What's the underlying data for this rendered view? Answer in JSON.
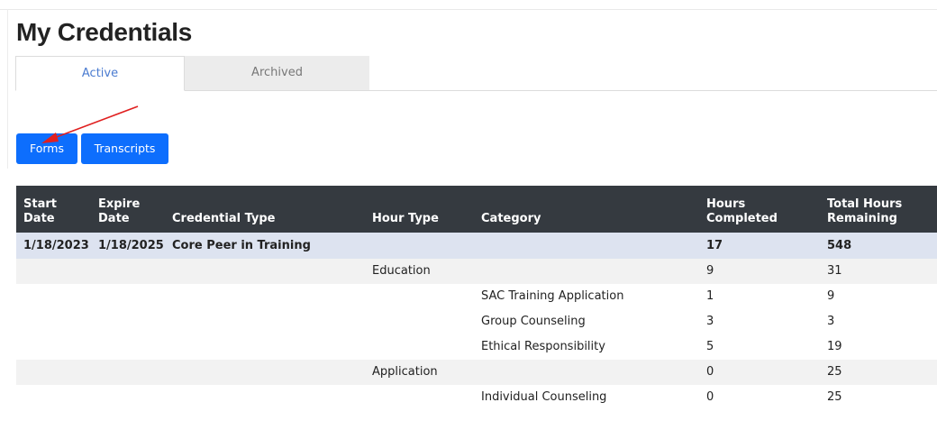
{
  "page": {
    "title": "My Credentials"
  },
  "tabs": [
    {
      "label": "Active",
      "active": true
    },
    {
      "label": "Archived",
      "active": false
    }
  ],
  "actions": {
    "forms_label": "Forms",
    "transcripts_label": "Transcripts"
  },
  "colors": {
    "button": "#0d6efd",
    "table_header": "#353a40",
    "credential_row": "#dde3f0",
    "annotation_arrow": "#e02020"
  },
  "table": {
    "headers": {
      "start_date": "Start Date",
      "expire_line1": "Expire",
      "expire_line2": "Date",
      "credential_type": "Credential Type",
      "hour_type": "Hour Type",
      "category": "Category",
      "completed_line1": "Hours",
      "completed_line2": "Completed",
      "remaining_line1": "Total Hours",
      "remaining_line2": "Remaining"
    },
    "rows": [
      {
        "start": "1/18/2023",
        "expire": "1/18/2025",
        "type": "Core Peer in Training",
        "hour_type": "",
        "category": "",
        "completed": "17",
        "remaining": "548"
      },
      {
        "start": "",
        "expire": "",
        "type": "",
        "hour_type": "Education",
        "category": "",
        "completed": "9",
        "remaining": "31"
      },
      {
        "start": "",
        "expire": "",
        "type": "",
        "hour_type": "",
        "category": "SAC Training Application",
        "completed": "1",
        "remaining": "9"
      },
      {
        "start": "",
        "expire": "",
        "type": "",
        "hour_type": "",
        "category": "Group Counseling",
        "completed": "3",
        "remaining": "3"
      },
      {
        "start": "",
        "expire": "",
        "type": "",
        "hour_type": "",
        "category": "Ethical Responsibility",
        "completed": "5",
        "remaining": "19"
      },
      {
        "start": "",
        "expire": "",
        "type": "",
        "hour_type": "Application",
        "category": "",
        "completed": "0",
        "remaining": "25"
      },
      {
        "start": "",
        "expire": "",
        "type": "",
        "hour_type": "",
        "category": "Individual Counseling",
        "completed": "0",
        "remaining": "25"
      }
    ]
  }
}
